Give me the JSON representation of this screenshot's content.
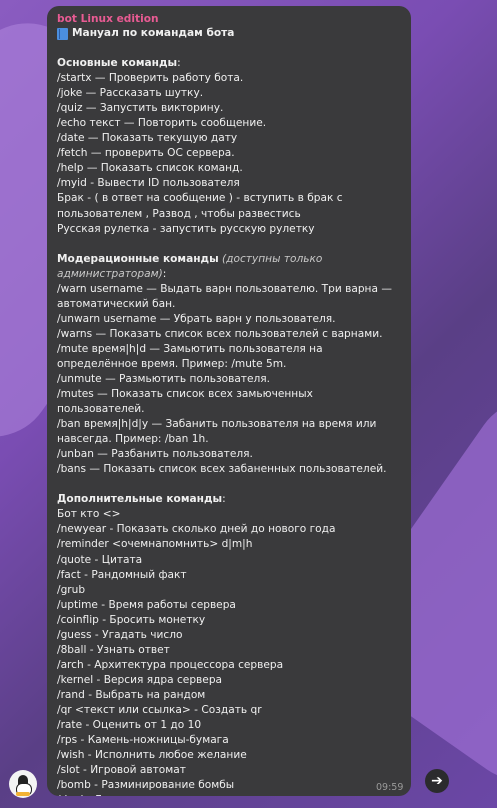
{
  "message": {
    "sender": "bot Linux edition",
    "title": "Мануал по командам бота",
    "time": "09:59",
    "sections": [
      {
        "heading": "Основные команды",
        "note": "",
        "lines": [
          "/startx — Проверить работу бота.",
          "/joke — Рассказать шутку.",
          "/quiz — Запустить викторину.",
          "/echo текст — Повторить сообщение.",
          "/date — Показать текущую дату",
          "/fetch — проверить ОС сервера.",
          "/help — Показать список команд.",
          "/myid - Вывести ID пользователя",
          "Брак - ( в ответ на сообщение ) - вступить в брак с",
          "пользователем , Развод , чтобы развестись",
          "Русская рулетка - запустить русскую рулетку"
        ]
      },
      {
        "heading": "Модерационные команды",
        "note": "(доступны только администраторам)",
        "lines": [
          "/warn username — Выдать варн пользователю. Три варна —",
          "автоматический бан.",
          "/unwarn username — Убрать варн у пользователя.",
          "/warns — Показать список всех пользователей с варнами.",
          "/mute время|h|d — Замьютить пользователя на",
          "определённое время. Пример: /mute 5m.",
          "/unmute — Размьютить пользователя.",
          "/mutes — Показать список всех замьюченных пользователей.",
          "/ban время|h|d|y — Забанить пользователя на время или",
          "навсегда. Пример: /ban 1h.",
          "/unban — Разбанить пользователя.",
          "/bans — Показать список всех забаненных пользователей."
        ]
      },
      {
        "heading": "Дополнительные команды",
        "note": "",
        "lines": [
          "Бот кто <>",
          "/newyear - Показать сколько дней до нового года",
          "/reminder <очемнапомнить> d|m|h",
          "/quote - Цитата",
          "/fact - Рандомный факт",
          "/grub",
          "/uptime - Время работы сервера",
          "/coinflip - Бросить монетку",
          "/guess - Угадать число",
          "/8ball - Узнать ответ",
          "/arch - Архитектура процессора сервера",
          "/kernel - Версия ядра сервера",
          "/rand - Выбрать на рандом",
          "/qr <текст или ссылка> - Создать qr",
          "/rate - Оценить от 1 до 10",
          "/rps - Камень-ножницы-бумага",
          "/wish - Исполнить любое желание",
          "/slot - Игровой автомат",
          "/bomb - Разминирование бомбы",
          "/duel - Дуэль с участниками"
        ]
      }
    ]
  },
  "icons": {
    "title_icon": "blue-book-icon",
    "avatar": "tux-penguin-avatar",
    "share": "share-arrow-icon"
  },
  "colors": {
    "sender": "#e85b93",
    "bubble": "#3a3a3c",
    "background": "#7a4db3"
  }
}
